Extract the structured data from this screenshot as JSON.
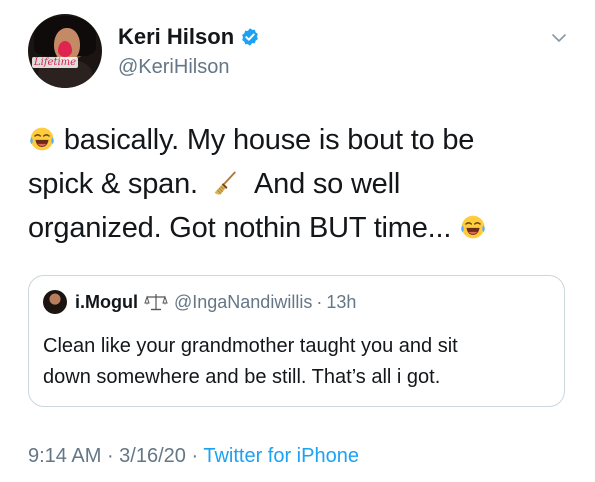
{
  "author": {
    "display_name": "Keri Hilson",
    "handle": "@KeriHilson",
    "verified": true,
    "avatar_logo_text": "Lifetime"
  },
  "tweet": {
    "lines": [
      "basically. My house is bout to be",
      "spick & span.",
      "And so well",
      "organized. Got nothin BUT time..."
    ],
    "emoji": [
      "face-with-tears-of-joy",
      "broom",
      "face-with-tears-of-joy"
    ]
  },
  "quoted_tweet": {
    "display_name": "i.Mogul",
    "handle": "@IngaNandiwillis",
    "separator": "·",
    "time": "13h",
    "lines": [
      "Clean like your grandmother taught you and sit",
      "down somewhere and be still. That’s all i got."
    ]
  },
  "meta": {
    "time": "9:14 AM",
    "sep1": " · ",
    "date": "3/16/20",
    "sep2": " · ",
    "source": "Twitter for iPhone"
  },
  "colors": {
    "accent": "#1da1f2",
    "secondary_text": "#657786",
    "border": "#ccd6dd"
  }
}
